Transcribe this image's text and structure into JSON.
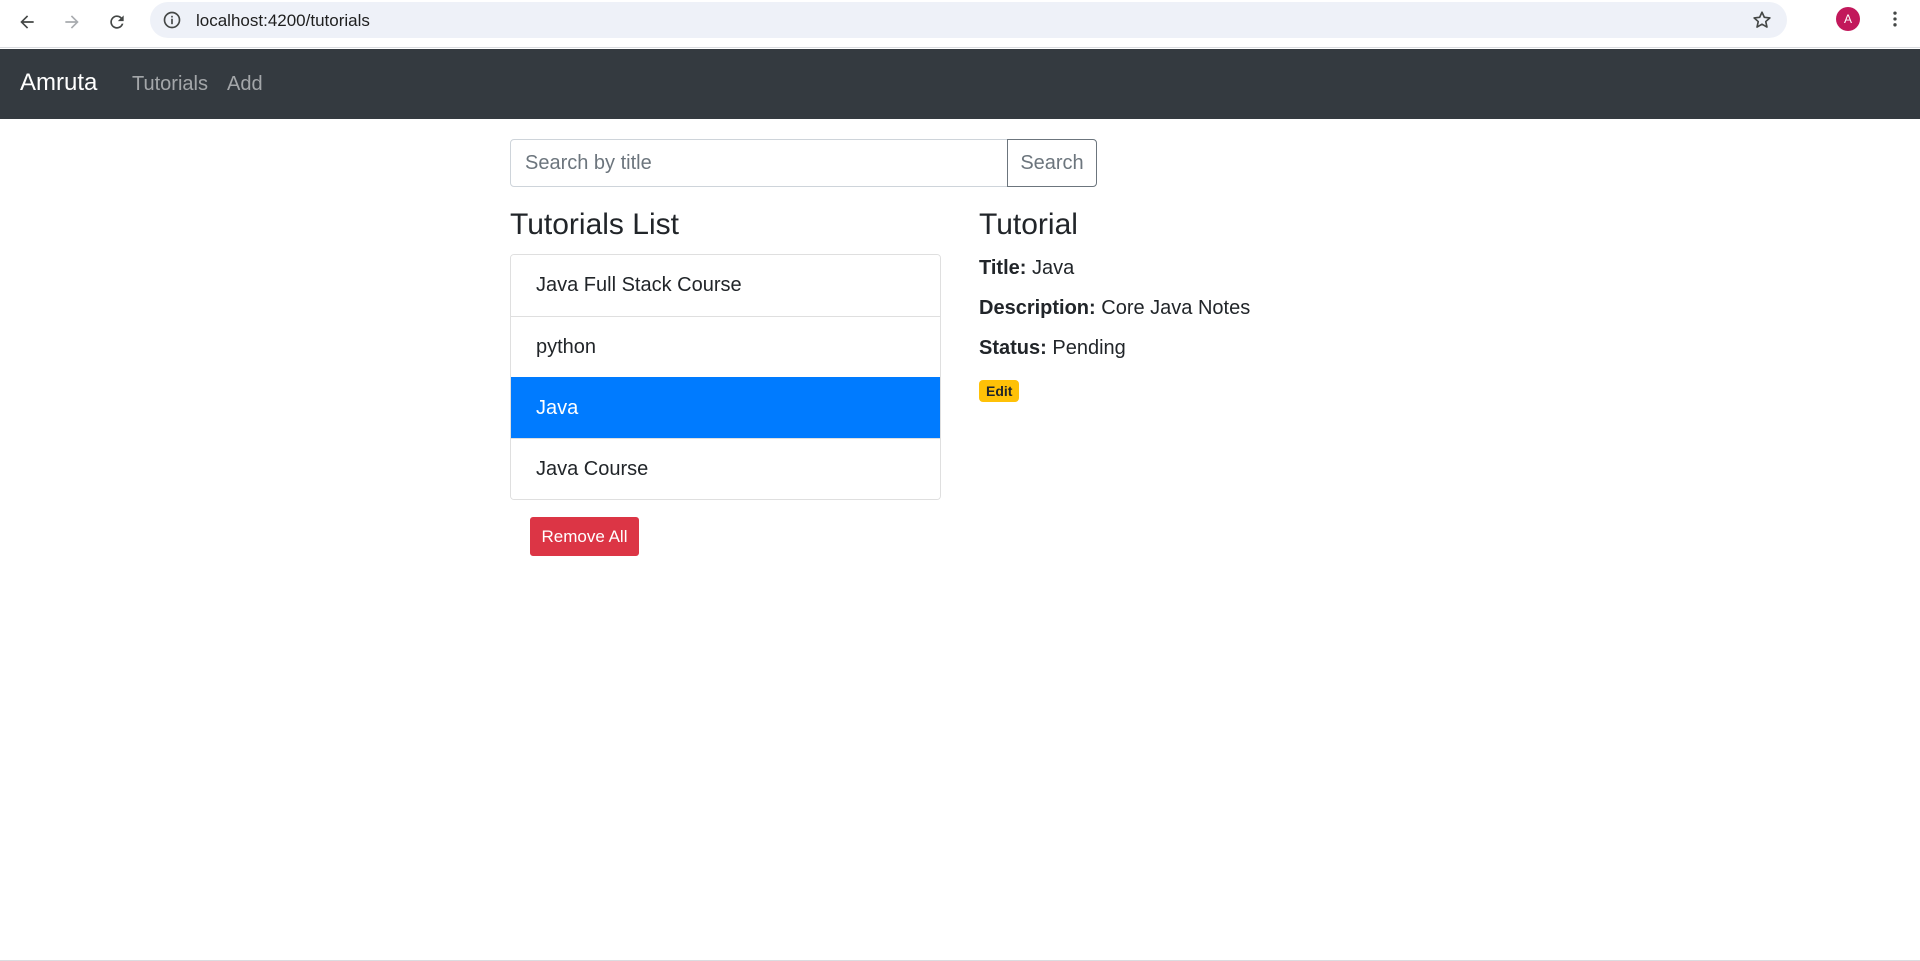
{
  "browser": {
    "url": "localhost:4200/tutorials",
    "profile_initial": "A",
    "icons": [
      "back-arrow-icon",
      "forward-arrow-icon",
      "reload-icon",
      "info-icon",
      "star-icon",
      "kebab-menu-icon"
    ]
  },
  "navbar": {
    "brand": "Amruta",
    "links": [
      {
        "label": "Tutorials"
      },
      {
        "label": "Add"
      }
    ]
  },
  "search": {
    "placeholder": "Search by title",
    "value": "",
    "button_label": "Search"
  },
  "list": {
    "heading": "Tutorials List",
    "items": [
      {
        "label": "Java Full Stack Course",
        "active": false
      },
      {
        "label": "python",
        "active": false
      },
      {
        "label": "Java",
        "active": true
      },
      {
        "label": "Java Course",
        "active": false
      }
    ],
    "remove_all_label": "Remove All"
  },
  "detail": {
    "heading": "Tutorial",
    "title_label": "Title:",
    "title_value": "Java",
    "description_label": "Description:",
    "description_value": "Core Java Notes",
    "status_label": "Status:",
    "status_value": "Pending",
    "edit_label": "Edit"
  },
  "colors": {
    "navbar_bg": "#343a40",
    "active_item": "#007bff",
    "danger": "#dc3545",
    "warning": "#ffc107"
  }
}
